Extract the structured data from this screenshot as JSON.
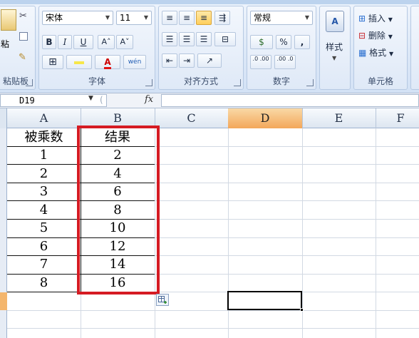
{
  "ribbon": {
    "clipboard": {
      "paste_label": "粘",
      "group_label": "粘贴板"
    },
    "font": {
      "font_name": "宋体",
      "font_size": "11",
      "bold": "B",
      "italic": "I",
      "underline": "U",
      "grow": "A˄",
      "shrink": "A˅",
      "phonetic": "wén",
      "group_label": "字体"
    },
    "alignment": {
      "group_label": "对齐方式"
    },
    "number": {
      "format": "常规",
      "percent": "%",
      "comma": ",",
      "inc_decimal": ".0 .00",
      "dec_decimal": ".00 .0",
      "group_label": "数字"
    },
    "styles": {
      "label": "样式"
    },
    "cells": {
      "insert": "插入",
      "delete": "删除",
      "format": "格式",
      "group_label": "单元格"
    }
  },
  "formula_bar": {
    "name_box": "D19",
    "fx": "fx",
    "formula": ""
  },
  "columns": [
    "A",
    "B",
    "C",
    "D",
    "E",
    "F"
  ],
  "selected_column": "D",
  "table": {
    "headers": [
      "被乘数",
      "结果"
    ],
    "rows": [
      [
        "1",
        "2"
      ],
      [
        "2",
        "4"
      ],
      [
        "3",
        "6"
      ],
      [
        "4",
        "8"
      ],
      [
        "5",
        "10"
      ],
      [
        "6",
        "12"
      ],
      [
        "7",
        "14"
      ],
      [
        "8",
        "16"
      ]
    ]
  },
  "colors": {
    "highlight_border": "#d51b23",
    "selected_header": "#f3a75a"
  }
}
